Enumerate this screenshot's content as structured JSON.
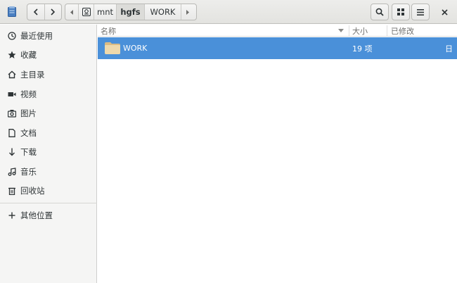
{
  "header": {
    "path": [
      "mnt",
      "hgfs",
      "WORK"
    ]
  },
  "sidebar": {
    "items": [
      {
        "label": "最近使用",
        "icon": "clock-icon"
      },
      {
        "label": "收藏",
        "icon": "star-icon"
      },
      {
        "label": "主目录",
        "icon": "home-icon"
      },
      {
        "label": "视频",
        "icon": "video-icon"
      },
      {
        "label": "图片",
        "icon": "camera-icon"
      },
      {
        "label": "文档",
        "icon": "document-icon"
      },
      {
        "label": "下载",
        "icon": "download-icon"
      },
      {
        "label": "音乐",
        "icon": "music-icon"
      },
      {
        "label": "回收站",
        "icon": "trash-icon"
      },
      {
        "label": "其他位置",
        "icon": "plus-icon"
      }
    ]
  },
  "columns": {
    "name": "名称",
    "size": "大小",
    "modified": "已修改"
  },
  "files": [
    {
      "name": "WORK",
      "size": "19 项",
      "modified": "日",
      "selected": true,
      "icon": "folder-icon"
    }
  ],
  "colors": {
    "selection": "#4a90d9",
    "folder": "#e8cfa0"
  }
}
